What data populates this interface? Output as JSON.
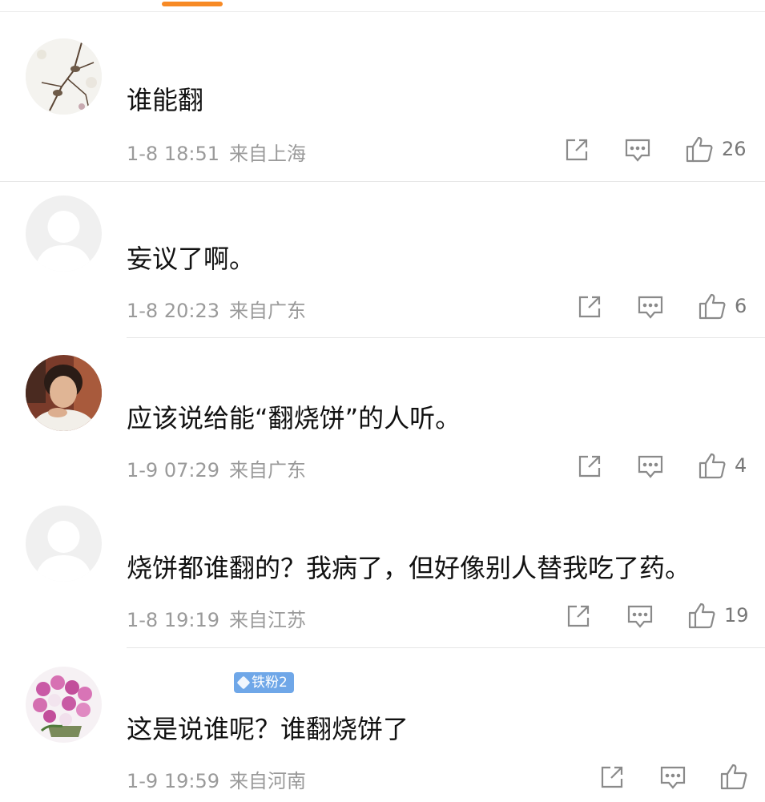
{
  "colors": {
    "accent": "#f78a25",
    "badge": "#6fa7e8",
    "meta_text": "#9a9a9a",
    "icon": "#8a8a8a"
  },
  "comments": [
    {
      "username": "",
      "content": "谁能翻",
      "time": "1-8 18:51",
      "location": "来自上海",
      "likes": "26",
      "avatar": "bird-branch-photo"
    },
    {
      "username": "",
      "content": "妄议了啊。",
      "time": "1-8 20:23",
      "location": "来自广东",
      "likes": "6",
      "avatar": "default-user"
    },
    {
      "username": "",
      "content": "应该说给能“翻烧饼”的人听。",
      "time": "1-9 07:29",
      "location": "来自广东",
      "likes": "4",
      "avatar": "woman-portrait"
    },
    {
      "username": "",
      "content": "烧饼都谁翻的？我病了，但好像别人替我吃了药。",
      "time": "1-8 19:19",
      "location": "来自江苏",
      "likes": "19",
      "avatar": "default-user"
    },
    {
      "username": "",
      "badge": "铁粉2",
      "content": "这是说谁呢？谁翻烧饼了",
      "time": "1-9 19:59",
      "location": "来自河南",
      "likes": "",
      "avatar": "orchid-flowers"
    }
  ]
}
